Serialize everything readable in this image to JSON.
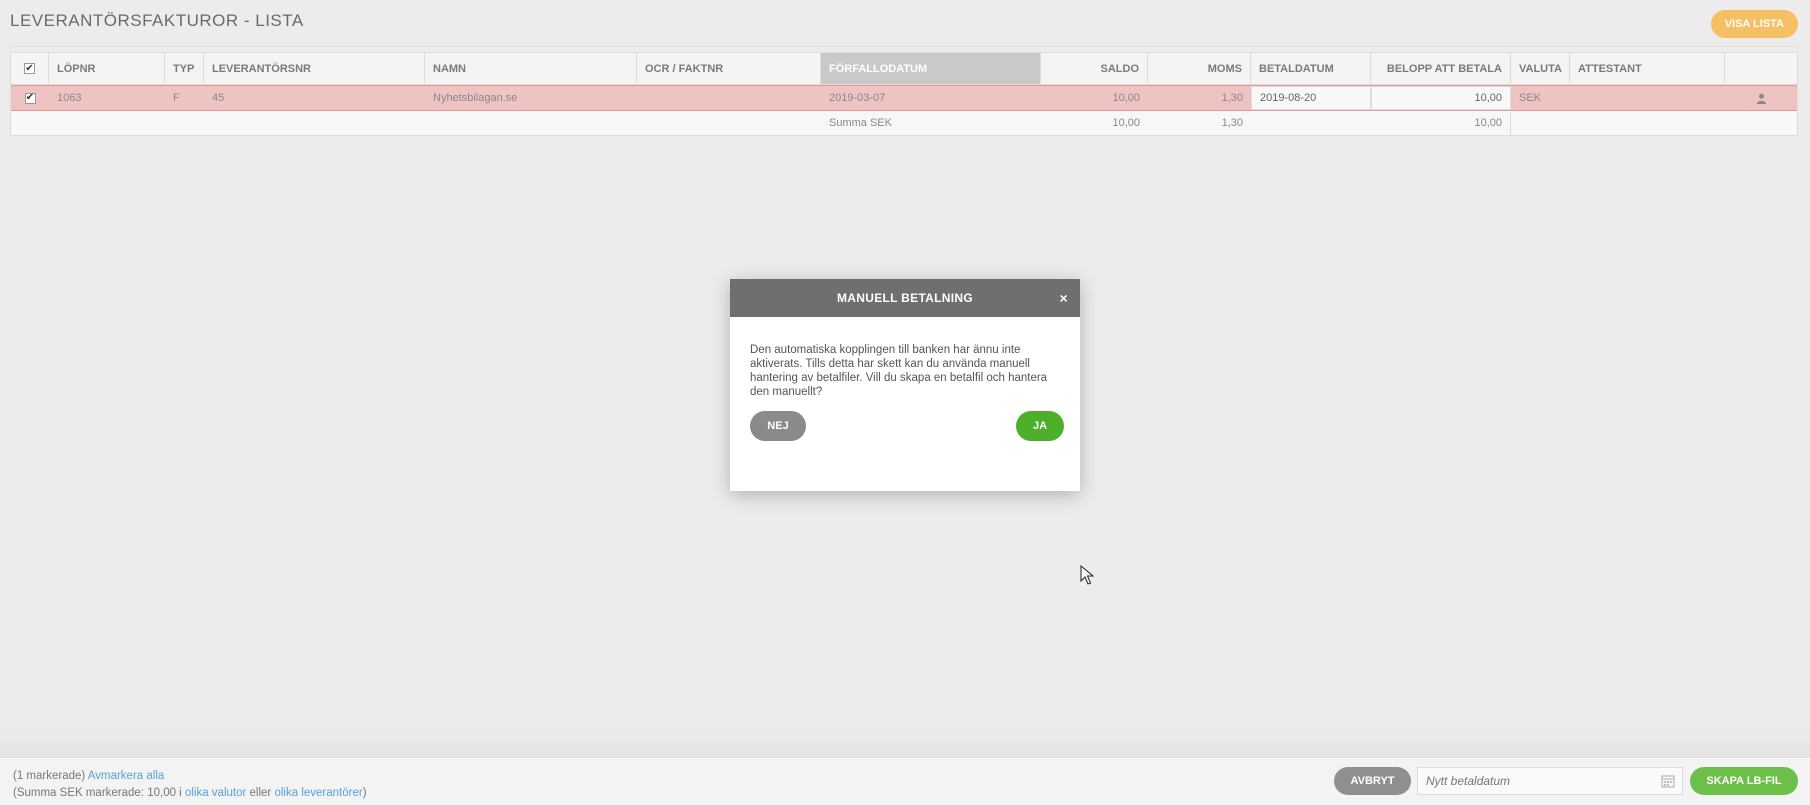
{
  "header": {
    "title": "LEVERANTÖRSFAKTUROR - LISTA",
    "visa_lista_label": "VISA LISTA"
  },
  "table": {
    "columns": {
      "lopnr": "LÖPNR",
      "typ": "TYP",
      "levnr": "LEVERANTÖRSNR",
      "namn": "NAMN",
      "ocr": "OCR / FAKTNR",
      "forfallodatum": "FÖRFALLODATUM",
      "saldo": "SALDO",
      "moms": "MOMS",
      "betaldatum": "BETALDATUM",
      "belopp": "BELOPP ATT BETALA",
      "valuta": "VALUTA",
      "attestant": "ATTESTANT"
    },
    "row": {
      "lopnr": "1063",
      "typ": "F",
      "levnr": "45",
      "namn": "Nyhetsbilagan.se",
      "ocr": "",
      "forfallodatum": "2019-03-07",
      "saldo": "10,00",
      "moms": "1,30",
      "betaldatum": "2019-08-20",
      "belopp": "10,00",
      "valuta": "SEK",
      "attestant": ""
    },
    "sum": {
      "label": "Summa SEK",
      "saldo": "10,00",
      "moms": "1,30",
      "belopp": "10,00"
    }
  },
  "modal": {
    "title": "MANUELL BETALNING",
    "close": "×",
    "text": "Den automatiska kopplingen till banken har ännu inte aktiverats. Tills detta har skett kan du använda manuell hantering av betalfiler. Vill du skapa en betalfil och hantera den manuellt?",
    "no_label": "NEJ",
    "yes_label": "JA"
  },
  "footer": {
    "marked": "(1 markerade)",
    "unmark_all": "Avmarkera alla",
    "sum_prefix": "(Summa SEK markerade: 10,00 i",
    "various_currencies": "olika valutor",
    "or": "eller",
    "various_suppliers": "olika leverantörer",
    "close_paren": ")",
    "cancel_label": "AVBRYT",
    "date_placeholder": "Nytt betaldatum",
    "create_label": "SKAPA LB-FIL"
  },
  "colors": {
    "accent_orange": "#f5bf64",
    "yes_green": "#4caf2a",
    "create_green": "#6cc04a",
    "selected_row": "#f0c3c3"
  },
  "icons": {
    "checkbox": "checkbox-icon",
    "user": "user-icon",
    "calendar": "calendar-icon",
    "close": "close-icon"
  }
}
